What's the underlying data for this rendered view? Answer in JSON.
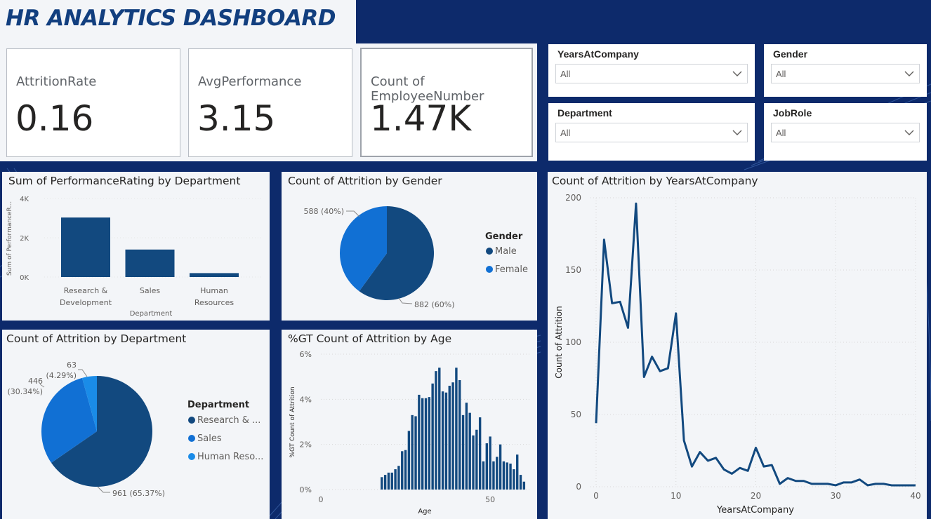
{
  "header": {
    "title": "HR ANALYTICS DASHBOARD"
  },
  "kpis": [
    {
      "label": "AttritionRate",
      "value": "0.16"
    },
    {
      "label": "AvgPerformance",
      "value": "3.15"
    },
    {
      "label": "Count of EmployeeNumber",
      "value": "1.47K"
    }
  ],
  "slicers": {
    "years_at_company": {
      "label": "YearsAtCompany",
      "value": "All"
    },
    "gender": {
      "label": "Gender",
      "value": "All"
    },
    "department": {
      "label": "Department",
      "value": "All"
    },
    "job_role": {
      "label": "JobRole",
      "value": "All"
    }
  },
  "colors": {
    "dark_blue": "#12497f",
    "mid_blue": "#1170d4",
    "light_blue": "#1a8ce8",
    "bg_navy": "#0d2a6b"
  },
  "chart_data": [
    {
      "id": "perf_by_dept",
      "type": "bar",
      "title": "Sum of PerformanceRating by Department",
      "xlabel": "Department",
      "ylabel": "Sum of PerformanceR...",
      "categories": [
        "Research & Development",
        "Sales",
        "Human Resources"
      ],
      "category_lines": [
        [
          "Research &",
          "Development"
        ],
        [
          "Sales"
        ],
        [
          "Human",
          "Resources"
        ]
      ],
      "values": [
        3030,
        1400,
        200
      ],
      "yticks": [
        "0K",
        "2K",
        "4K"
      ],
      "ylim": [
        0,
        4000
      ]
    },
    {
      "id": "attrition_by_gender",
      "type": "pie",
      "title": "Count of Attrition by Gender",
      "legend_title": "Gender",
      "labels": [
        "Male",
        "Female"
      ],
      "values": [
        882,
        588
      ],
      "data_labels": [
        "882 (60%)",
        "588 (40%)"
      ],
      "colors": [
        "#12497f",
        "#1170d4"
      ]
    },
    {
      "id": "attrition_by_years",
      "type": "line",
      "title": "Count of Attrition by YearsAtCompany",
      "xlabel": "YearsAtCompany",
      "ylabel": "Count of Attrition",
      "x": [
        0,
        1,
        2,
        3,
        4,
        5,
        6,
        7,
        8,
        9,
        10,
        11,
        12,
        13,
        14,
        15,
        16,
        17,
        18,
        19,
        20,
        21,
        22,
        23,
        24,
        25,
        26,
        27,
        28,
        29,
        30,
        31,
        32,
        33,
        34,
        35,
        36,
        37,
        40
      ],
      "y": [
        44,
        171,
        127,
        128,
        110,
        196,
        76,
        90,
        80,
        82,
        120,
        32,
        14,
        24,
        18,
        20,
        12,
        9,
        13,
        11,
        27,
        14,
        15,
        2,
        6,
        4,
        4,
        2,
        2,
        2,
        1,
        3,
        3,
        5,
        1,
        2,
        2,
        1,
        1
      ],
      "xticks": [
        0,
        10,
        20,
        30,
        40
      ],
      "yticks": [
        0,
        50,
        100,
        150,
        200
      ],
      "xlim": [
        0,
        40
      ],
      "ylim": [
        0,
        200
      ]
    },
    {
      "id": "attrition_by_dept",
      "type": "pie",
      "title": "Count of Attrition by Department",
      "legend_title": "Department",
      "labels": [
        "Research & ...",
        "Sales",
        "Human Reso..."
      ],
      "values": [
        961,
        446,
        63
      ],
      "data_labels": [
        "961 (65.37%)",
        "446\n(30.34%)",
        "63\n(4.29%)"
      ],
      "colors": [
        "#12497f",
        "#1170d4",
        "#1a8ce8"
      ]
    },
    {
      "id": "pct_attrition_by_age",
      "type": "bar",
      "title": "%GT Count of Attrition by Age",
      "xlabel": "Age",
      "ylabel": "%GT Count of Attrition",
      "x": [
        18,
        19,
        20,
        21,
        22,
        23,
        24,
        25,
        26,
        27,
        28,
        29,
        30,
        31,
        32,
        33,
        34,
        35,
        36,
        37,
        38,
        39,
        40,
        41,
        42,
        43,
        44,
        45,
        46,
        47,
        48,
        49,
        50,
        51,
        52,
        53,
        54,
        55,
        56,
        57,
        58,
        59,
        60
      ],
      "y": [
        0.55,
        0.65,
        0.75,
        0.75,
        0.9,
        1.05,
        1.7,
        1.75,
        2.6,
        3.3,
        3.25,
        4.2,
        4.05,
        4.05,
        4.1,
        4.7,
        5.25,
        5.4,
        4.35,
        4.3,
        4.6,
        4.75,
        5.4,
        4.85,
        3.3,
        3.85,
        3.4,
        2.4,
        2.65,
        3.2,
        1.25,
        2.05,
        2.35,
        1.25,
        1.45,
        2.0,
        1.25,
        1.2,
        1.15,
        0.9,
        1.55,
        0.65,
        0.35
      ],
      "xticks": [
        0,
        50
      ],
      "yticks": [
        "0%",
        "2%",
        "4%",
        "6%"
      ],
      "xlim": [
        0,
        62
      ],
      "ylim": [
        0,
        6
      ]
    }
  ]
}
